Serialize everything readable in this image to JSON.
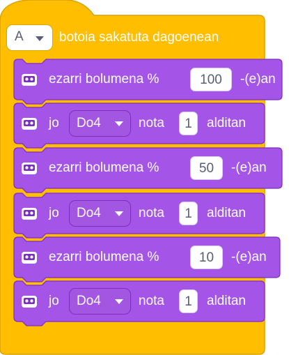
{
  "colors": {
    "event": "#ffbf00",
    "event_border": "#d9a300",
    "sound": "#a455e8",
    "sound_border": "#7c2fbd"
  },
  "hat": {
    "button_value": "A",
    "label": "botoia sakatuta dagoenean"
  },
  "blocks": [
    {
      "type": "set-volume",
      "icon": "robot-face-icon",
      "prefix": "ezarri bolumena %",
      "value": "100",
      "suffix": "-(e)an"
    },
    {
      "type": "play-note",
      "icon": "robot-face-icon",
      "prefix": "jo",
      "note": "Do4",
      "middle": "nota",
      "value": "1",
      "suffix": "alditan"
    },
    {
      "type": "set-volume",
      "icon": "robot-face-icon",
      "prefix": "ezarri bolumena %",
      "value": "50",
      "suffix": "-(e)an"
    },
    {
      "type": "play-note",
      "icon": "robot-face-icon",
      "prefix": "jo",
      "note": "Do4",
      "middle": "nota",
      "value": "1",
      "suffix": "alditan"
    },
    {
      "type": "set-volume",
      "icon": "robot-face-icon",
      "prefix": "ezarri bolumena %",
      "value": "10",
      "suffix": "-(e)an"
    },
    {
      "type": "play-note",
      "icon": "robot-face-icon",
      "prefix": "jo",
      "note": "Do4",
      "middle": "nota",
      "value": "1",
      "suffix": "alditan"
    }
  ]
}
